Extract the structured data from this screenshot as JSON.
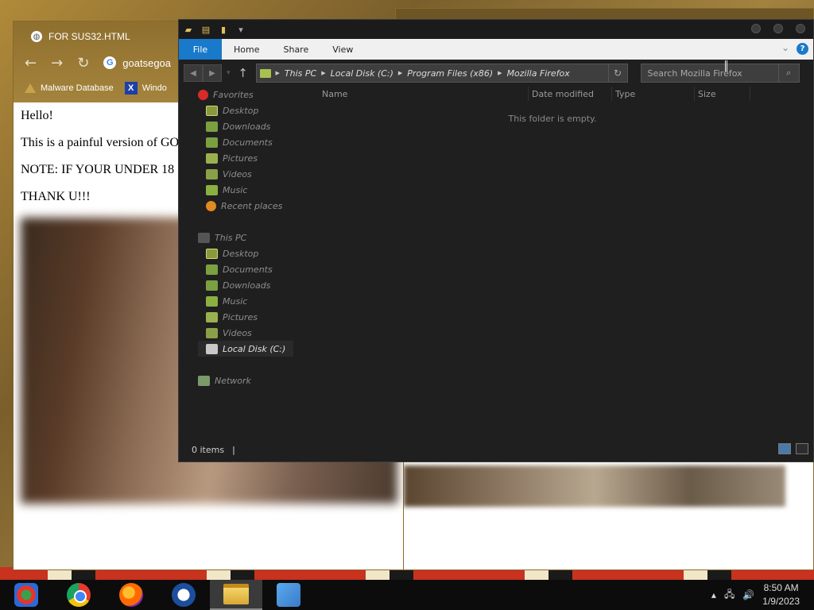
{
  "browser": {
    "tab_title": "FOR SUS32.HTML",
    "address_text": "goatsegoa",
    "bookmarks": [
      {
        "label": "Malware Database",
        "icon": "bookmark-triangle-icon"
      },
      {
        "label": "Windo",
        "icon": "x-icon"
      }
    ],
    "page_lines": [
      "Hello!",
      "This is a painful version of GO",
      "NOTE: IF YOUR UNDER 18",
      "THANK U!!!"
    ]
  },
  "explorer": {
    "ribbon_tabs": {
      "file": "File",
      "home": "Home",
      "share": "Share",
      "view": "View"
    },
    "breadcrumbs": [
      "This PC",
      "Local Disk (C:)",
      "Program Files (x86)",
      "Mozilla Firefox"
    ],
    "search_placeholder": "Search Mozilla Firefox",
    "nav": {
      "favorites_label": "Favorites",
      "favorites": [
        {
          "label": "Desktop",
          "icon": "desktop-icon"
        },
        {
          "label": "Downloads",
          "icon": "downloads-icon"
        },
        {
          "label": "Documents",
          "icon": "documents-icon"
        },
        {
          "label": "Pictures",
          "icon": "pictures-icon"
        },
        {
          "label": "Videos",
          "icon": "videos-icon"
        },
        {
          "label": "Music",
          "icon": "music-icon"
        },
        {
          "label": "Recent places",
          "icon": "recent-icon"
        }
      ],
      "thispc_label": "This PC",
      "thispc": [
        {
          "label": "Desktop",
          "icon": "desktop-icon"
        },
        {
          "label": "Documents",
          "icon": "documents-icon"
        },
        {
          "label": "Downloads",
          "icon": "downloads-icon"
        },
        {
          "label": "Music",
          "icon": "music-icon"
        },
        {
          "label": "Pictures",
          "icon": "pictures-icon"
        },
        {
          "label": "Videos",
          "icon": "videos-icon"
        },
        {
          "label": "Local Disk (C:)",
          "icon": "disk-icon"
        }
      ],
      "network_label": "Network"
    },
    "columns": {
      "name": "Name",
      "date": "Date modified",
      "type": "Type",
      "size": "Size"
    },
    "empty_message": "This folder is empty.",
    "status": "0 items"
  },
  "taskbar": {
    "time": "8:50 AM",
    "date": "1/9/2023",
    "apps": [
      "start-orb-icon",
      "chrome-icon",
      "firefox-icon",
      "obama-logo-icon",
      "file-explorer-icon",
      "windows-live-messenger-icon"
    ]
  }
}
